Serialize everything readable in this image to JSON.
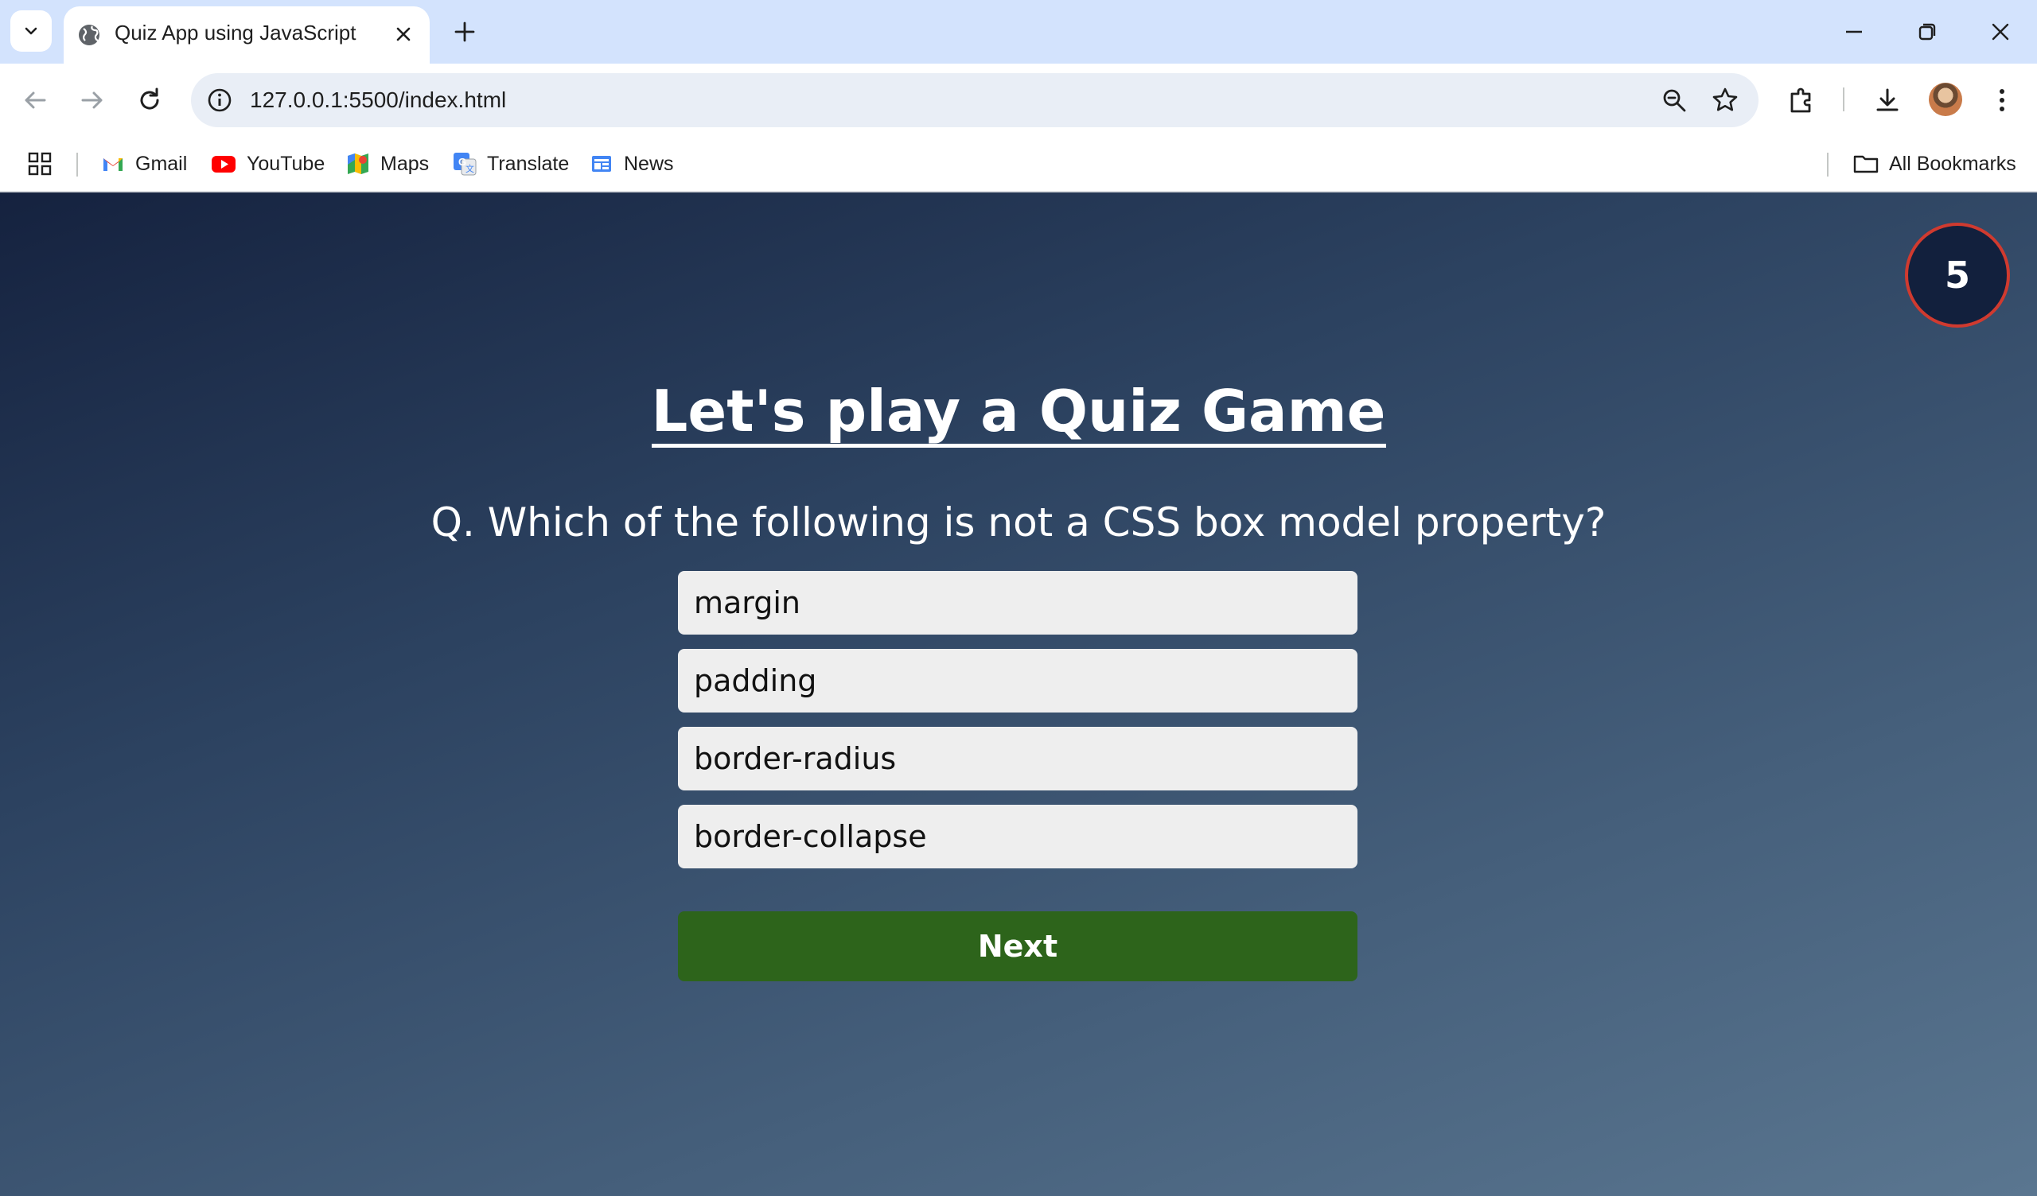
{
  "browser": {
    "tab_title": "Quiz App using JavaScript",
    "url": "127.0.0.1:5500/index.html",
    "bookmarks": [
      {
        "label": "Gmail",
        "icon": "gmail-icon"
      },
      {
        "label": "YouTube",
        "icon": "youtube-icon"
      },
      {
        "label": "Maps",
        "icon": "maps-icon"
      },
      {
        "label": "Translate",
        "icon": "translate-icon"
      },
      {
        "label": "News",
        "icon": "news-icon"
      }
    ],
    "all_bookmarks_label": "All Bookmarks"
  },
  "quiz": {
    "timer": "5",
    "title": "Let's play a Quiz Game",
    "question": "Q. Which of the following is not a CSS box model property?",
    "options": [
      "margin",
      "padding",
      "border-radius",
      "border-collapse"
    ],
    "next_label": "Next"
  },
  "colors": {
    "tabstrip": "#d3e3fd",
    "omnibox": "#e9eef6",
    "page_gradient_start": "#15223f",
    "page_gradient_end": "#5a7690",
    "timer_bg": "#12203d",
    "timer_border": "#d03a2f",
    "option_bg": "#eeeeee",
    "next_bg": "#2d641b"
  }
}
